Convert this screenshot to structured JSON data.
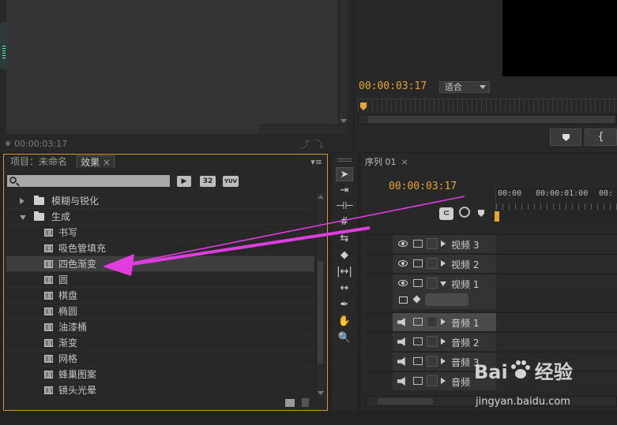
{
  "source_monitor": {
    "timecode": "00:00:03:17"
  },
  "program_monitor": {
    "timecode": "00:00:03:17",
    "zoom_select": "适合",
    "brace_button": "{"
  },
  "effects_panel": {
    "tab_project": "项目：未命名",
    "tab_effects": "效果",
    "tab_close": "×",
    "menu_glyph": "▾≡",
    "search_placeholder": "",
    "badges": [
      "32",
      "YUV"
    ],
    "items": [
      {
        "label": "模糊与锐化",
        "type": "folder",
        "expanded": false,
        "indent": 0
      },
      {
        "label": "生成",
        "type": "folder",
        "expanded": true,
        "indent": 0
      },
      {
        "label": "书写",
        "type": "effect",
        "indent": 1
      },
      {
        "label": "吸色管填充",
        "type": "effect",
        "indent": 1
      },
      {
        "label": "四色渐变",
        "type": "effect",
        "indent": 1,
        "selected": true
      },
      {
        "label": "圆",
        "type": "effect",
        "indent": 1
      },
      {
        "label": "棋盘",
        "type": "effect",
        "indent": 1
      },
      {
        "label": "椭圆",
        "type": "effect",
        "indent": 1
      },
      {
        "label": "油漆桶",
        "type": "effect",
        "indent": 1
      },
      {
        "label": "渐变",
        "type": "effect",
        "indent": 1
      },
      {
        "label": "网格",
        "type": "effect",
        "indent": 1
      },
      {
        "label": "蜂巢图案",
        "type": "effect",
        "indent": 1
      },
      {
        "label": "镜头光晕",
        "type": "effect",
        "indent": 1
      }
    ]
  },
  "tools": [
    {
      "name": "selection-tool",
      "glyph": "➤",
      "active": true
    },
    {
      "name": "track-select-tool",
      "glyph": "⇥"
    },
    {
      "name": "ripple-edit-tool",
      "glyph": "⊣⊢"
    },
    {
      "name": "rolling-edit-tool",
      "glyph": "#"
    },
    {
      "name": "rate-stretch-tool",
      "glyph": "⇆"
    },
    {
      "name": "razor-tool",
      "glyph": "◆"
    },
    {
      "name": "slip-tool",
      "glyph": "|↔|"
    },
    {
      "name": "slide-tool",
      "glyph": "↔"
    },
    {
      "name": "pen-tool",
      "glyph": "✒"
    },
    {
      "name": "hand-tool",
      "glyph": "✋"
    },
    {
      "name": "zoom-tool",
      "glyph": "🔍"
    }
  ],
  "sequence": {
    "tab_label": "序列 01",
    "tab_close": "×",
    "timecode": "00:00:03:17",
    "ruler_labels": [
      "00:00",
      "00:00:01:00",
      "00:"
    ],
    "tracks": [
      {
        "type": "video",
        "label": "视频 3",
        "expanded": false
      },
      {
        "type": "video",
        "label": "视频 2",
        "expanded": false
      },
      {
        "type": "video",
        "label": "视频 1",
        "expanded": true
      },
      {
        "type": "audio",
        "label": "音频 1",
        "expanded": false,
        "selected": true
      },
      {
        "type": "audio",
        "label": "音频 2",
        "expanded": false
      },
      {
        "type": "audio",
        "label": "音频 3",
        "expanded": false
      },
      {
        "type": "audio",
        "label": "音频",
        "expanded": false
      }
    ]
  },
  "annotation": {
    "arrow_color": "#e03de0"
  },
  "watermark": {
    "logo": "Bai",
    "logo_suffix": "经验",
    "url": "jingyan.baidu.com"
  },
  "colors": {
    "timecode": "#e8a534",
    "active_panel_border": "#d49a28"
  }
}
